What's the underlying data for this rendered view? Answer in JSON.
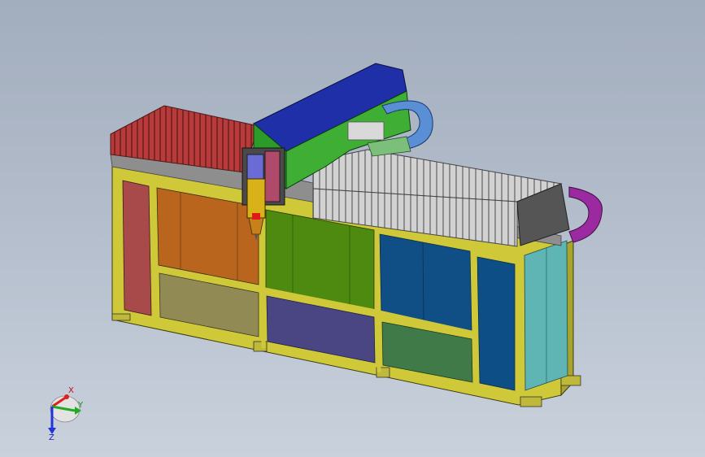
{
  "triad": {
    "x_label": "X",
    "y_label": "Y",
    "z_label": "Z",
    "x_color": "#e02020",
    "y_color": "#22aa22",
    "z_color": "#2233dd"
  },
  "colors": {
    "background": "#b0bac9",
    "frame": "#d8d23a",
    "red_bellows": "#b73b3b",
    "grey_bellows": "#c9c9c9",
    "gantry_top": "#1f2fa8",
    "gantry_side": "#3fae34",
    "cable_chain": "#5a8fd6",
    "cable_chain_right": "#9b2aa0",
    "panel_pink": "#a84a4a",
    "panel_orange": "#b9651e",
    "panel_green": "#4f8a10",
    "panel_blue": "#0f4f86",
    "panel_olive": "#918a55",
    "panel_purple": "#4a4583",
    "panel_darkgreen": "#3f7a48",
    "panel_navy": "#0d4e86",
    "panel_cyan": "#5fb4b4",
    "spindle": "#d9b21a"
  },
  "icons": {
    "triad": "coordinate-triad-icon"
  }
}
